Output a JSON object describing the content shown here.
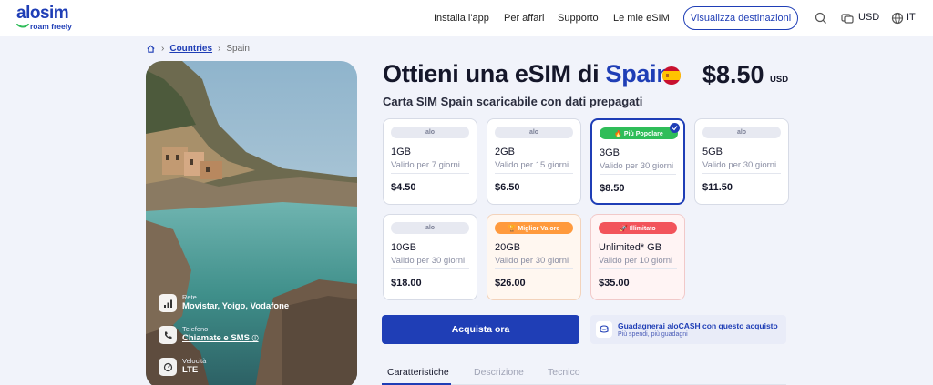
{
  "brand": {
    "name": "alosim",
    "tagline": "roam freely"
  },
  "nav": {
    "install": "Installa l'app",
    "business": "Per affari",
    "support": "Supporto",
    "my_esim": "Le mie eSIM",
    "destinations_button": "Visualizza destinazioni",
    "currency": "USD",
    "language": "IT"
  },
  "breadcrumb": {
    "items": [
      "Countries",
      "Spain"
    ]
  },
  "hero": {
    "specs": [
      {
        "label": "Rete",
        "value": "Movistar, Yoigo, Vodafone",
        "icon": "signal-icon"
      },
      {
        "label": "Telefono",
        "value": "Chiamate e SMS",
        "icon": "phone-icon"
      },
      {
        "label": "Velocità",
        "value": "LTE",
        "icon": "speedometer-icon"
      }
    ]
  },
  "product": {
    "title_prefix": "Ottieni una eSIM di",
    "country": "Spain",
    "price": "$8.50",
    "price_currency": "USD",
    "subtitle": "Carta SIM Spain scaricabile con dati prepagati"
  },
  "plans": [
    {
      "badge": "alo",
      "data": "1GB",
      "validity": "Valido per 7 giorni",
      "price": "$4.50"
    },
    {
      "badge": "alo",
      "data": "2GB",
      "validity": "Valido per 15 giorni",
      "price": "$6.50"
    },
    {
      "badge": "🔥 Più Popolare",
      "data": "3GB",
      "validity": "Valido per 30 giorni",
      "price": "$8.50",
      "selected": true
    },
    {
      "badge": "alo",
      "data": "5GB",
      "validity": "Valido per 30 giorni",
      "price": "$11.50"
    },
    {
      "badge": "alo",
      "data": "10GB",
      "validity": "Valido per 30 giorni",
      "price": "$18.00"
    },
    {
      "badge": "🏆 Miglior Valore",
      "data": "20GB",
      "validity": "Valido per 30 giorni",
      "price": "$26.00"
    },
    {
      "badge": "🚀 Illimitato",
      "data": "Unlimited* GB",
      "validity": "Valido per 10 giorni",
      "price": "$35.00"
    }
  ],
  "buy": {
    "button": "Acquista ora",
    "cash_title": "Guadagnerai aloCASH con questo acquisto",
    "cash_sub": "Più spendi, più guadagni"
  },
  "tabs": [
    "Caratteristiche",
    "Descrizione",
    "Tecnico"
  ],
  "colors": {
    "brand": "#1f3eb6",
    "popular": "#2fbd59",
    "best_value": "#ff9a3d",
    "unlimited": "#f2545b"
  }
}
